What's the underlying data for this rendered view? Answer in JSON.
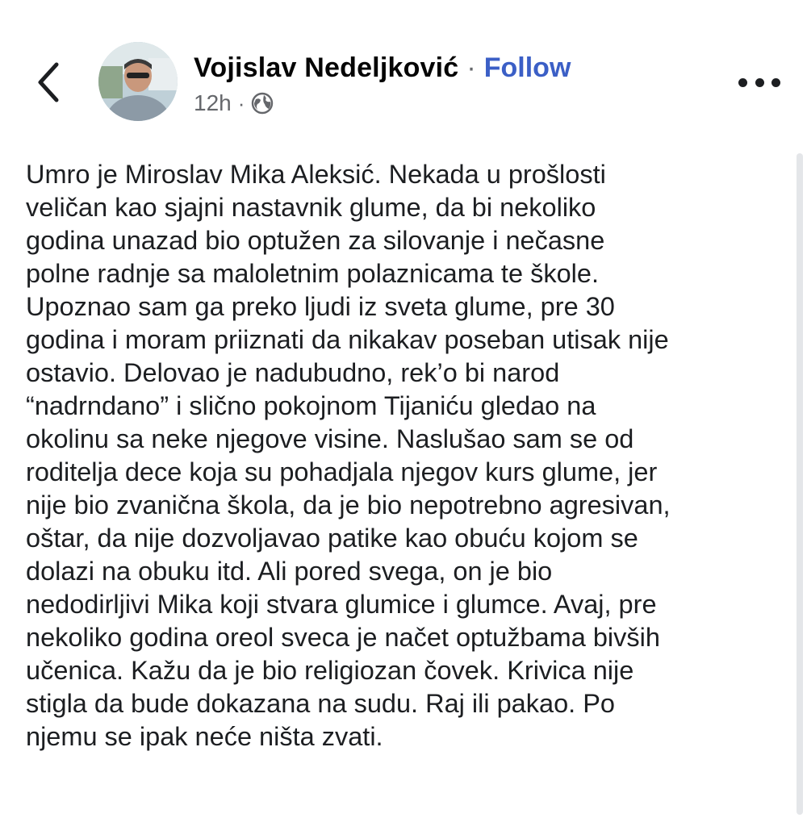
{
  "header": {
    "author_name": "Vojislav Nedeljković",
    "separator": "·",
    "follow_label": "Follow",
    "time": "12h",
    "meta_separator": "·",
    "privacy_icon": "globe-icon",
    "back_icon": "chevron-left-icon",
    "more_icon": "more-horizontal-icon"
  },
  "post": {
    "lines": [
      "Umro je Miroslav Mika Aleksić. Nekada u prošlosti",
      "veličan kao sjajni nastavnik glume, da bi nekoliko",
      "godina unazad bio optužen za silovanje i nečasne",
      "polne radnje sa maloletnim polaznicama te škole.",
      "Upoznao sam ga preko ljudi iz sveta glume, pre 30",
      "godina i moram priiznati da nikakav poseban utisak nije",
      "ostavio. Delovao je nadubudno, rek’o bi narod",
      "“nadrndano” i slično pokojnom Tijaniću gledao na",
      "okolinu sa neke njegove visine. Naslušao sam se od",
      "roditelja dece koja su pohadjala njegov kurs glume, jer",
      "nije bio zvanična škola, da je bio nepotrebno agresivan,",
      "oštar, da nije dozvoljavao patike kao obuću kojom se",
      "dolazi na obuku itd. Ali pored svega, on je bio",
      "nedodirljivi Mika koji stvara glumice i glumce. Avaj, pre",
      "nekoliko godina oreol sveca je načet optužbama bivših",
      "učenica. Kažu da je bio religiozan čovek. Krivica nije",
      "stigla da bude dokazana na sudu. Raj ili pakao. Po",
      "njemu se ipak neće ništa zvati."
    ]
  },
  "colors": {
    "follow": "#3b5fc6",
    "text": "#1c1e21",
    "meta": "#65676b",
    "background": "#ffffff"
  }
}
